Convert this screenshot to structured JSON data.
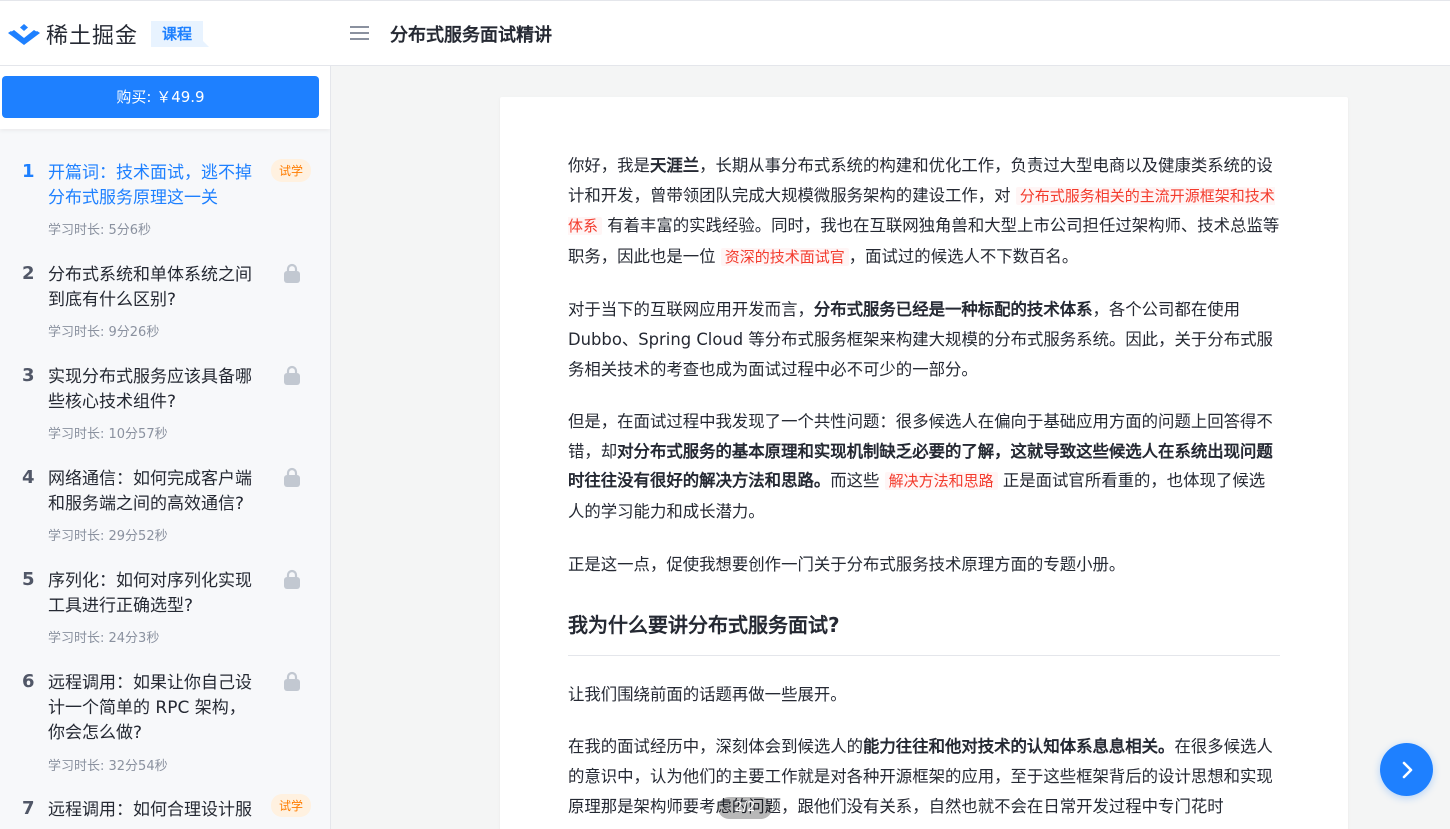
{
  "header": {
    "brand": "稀土掘金",
    "course_tag": "课程",
    "title": "分布式服务面试精讲"
  },
  "sidebar": {
    "buy_label": "购买: ￥49.9",
    "chapters": [
      {
        "num": "1",
        "title": "开篇词：技术面试，逃不掉分布式服务原理这一关",
        "duration": "学习时长: 5分6秒",
        "badge": "试学"
      },
      {
        "num": "2",
        "title": "分布式系统和单体系统之间到底有什么区别?",
        "duration": "学习时长: 9分26秒"
      },
      {
        "num": "3",
        "title": "实现分布式服务应该具备哪些核心技术组件?",
        "duration": "学习时长: 10分57秒"
      },
      {
        "num": "4",
        "title": "网络通信：如何完成客户端和服务端之间的高效通信?",
        "duration": "学习时长: 29分52秒"
      },
      {
        "num": "5",
        "title": "序列化：如何对序列化实现工具进行正确选型?",
        "duration": "学习时长: 24分3秒"
      },
      {
        "num": "6",
        "title": "远程调用：如果让你自己设计一个简单的 RPC 架构，你会怎么做?",
        "duration": "学习时长: 32分54秒"
      },
      {
        "num": "7",
        "title": "远程调用：如何合理设计服",
        "badge": "试学"
      }
    ]
  },
  "article": {
    "p1": {
      "a": "你好，我是",
      "b_name": "天涯兰",
      "c": "，长期从事分布式系统的构建和优化工作，负责过大型电商以及健康类系统的设计和开发，曾带领团队完成大规模微服务架构的建设工作，对 ",
      "hl1": "分布式服务相关的主流开源框架和技术体系",
      "d": " 有着丰富的实践经验。同时，我也在互联网独角兽和大型上市公司担任过架构师、技术总监等职务，因此也是一位 ",
      "hl2": "资深的技术面试官",
      "e": "，面试过的候选人不下数百名。"
    },
    "p2": {
      "a": "对于当下的互联网应用开发而言，",
      "b": "分布式服务已经是一种标配的技术体系",
      "c": "，各个公司都在使用 Dubbo、Spring Cloud 等分布式服务框架来构建大规模的分布式服务系统。因此，关于分布式服务相关技术的考查也成为面试过程中必不可少的一部分。"
    },
    "p3": {
      "a": "但是，在面试过程中我发现了一个共性问题：很多候选人在偏向于基础应用方面的问题上回答得不错，却",
      "b": "对分布式服务的基本原理和实现机制缺乏必要的了解，这就导致这些候选人在系统出现问题时往往没有很好的解决方法和思路。",
      "c": "而这些 ",
      "hl": "解决方法和思路",
      "d": " 正是面试官所看重的，也体现了候选人的学习能力和成长潜力。"
    },
    "p4": "正是这一点，促使我想要创作一门关于分布式服务技术原理方面的专题小册。",
    "h2": "我为什么要讲分布式服务面试?",
    "p5": "让我们围绕前面的话题再做一些展开。",
    "p6": {
      "a": "在我的面试经历中，深刻体会到候选人的",
      "b": "能力往往和他对技术的认知体系息息相关。",
      "c": "在很多候选人的意识中，认为他们的主要工作就是对各种开源框架的应用，至于这些框架背后的设计思想和实现原理那是架构师要考虑的问题，跟他们没有关系，自然也就不会在日常开发过程中专门花时"
    }
  },
  "page_indicator": "2/2",
  "colors": {
    "accent": "#1e80ff",
    "highlight": "#f33b2d",
    "trial": "#ff7d00"
  }
}
